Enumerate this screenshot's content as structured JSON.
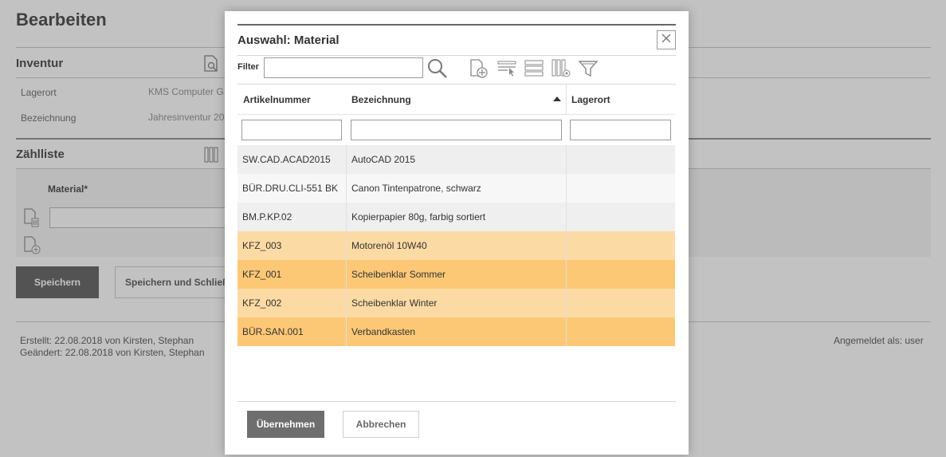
{
  "background_page": {
    "title": "Bearbeiten",
    "inventur": {
      "heading": "Inventur",
      "fields": [
        {
          "label": "Lagerort",
          "value": "KMS Computer G"
        },
        {
          "label": "Bezeichnung",
          "value": "Jahresinventur 20"
        }
      ]
    },
    "zaehlliste": {
      "heading": "Zählliste",
      "column_header": "Material*"
    },
    "buttons": {
      "save": "Speichern",
      "save_close": "Speichern und Schließ"
    },
    "footer": {
      "created": "Erstellt:  22.08.2018 von Kirsten, Stephan",
      "modified": "Geändert:  22.08.2018 von Kirsten, Stephan",
      "logged_in": "Angemeldet als: user"
    }
  },
  "dialog": {
    "title": "Auswahl: Material",
    "filter_label": "Filter",
    "filter_value": "",
    "icons": [
      "search-icon",
      "add-document-icon",
      "select-rows-icon",
      "list-view-icon",
      "column-settings-icon",
      "funnel-filter-icon"
    ],
    "table": {
      "columns": [
        {
          "key": "artikelnummer",
          "label": "Artikelnummer"
        },
        {
          "key": "bezeichnung",
          "label": "Bezeichnung",
          "sort": "ascending"
        },
        {
          "key": "lagerort",
          "label": "Lagerort"
        }
      ],
      "rows": [
        {
          "artikelnummer": "SW.CAD.ACAD2015",
          "bezeichnung": "AutoCAD 2015",
          "lagerort": "",
          "highlight": "none"
        },
        {
          "artikelnummer": "BÜR.DRU.CLI-551 BK",
          "bezeichnung": "Canon Tintenpatrone, schwarz",
          "lagerort": "",
          "highlight": "none"
        },
        {
          "artikelnummer": "BM.P.KP.02",
          "bezeichnung": "Kopierpapier 80g, farbig sortiert",
          "lagerort": "",
          "highlight": "none"
        },
        {
          "artikelnummer": "KFZ_003",
          "bezeichnung": "Motorenöl 10W40",
          "lagerort": "",
          "highlight": "light"
        },
        {
          "artikelnummer": "KFZ_001",
          "bezeichnung": "Scheibenklar Sommer",
          "lagerort": "",
          "highlight": "strong"
        },
        {
          "artikelnummer": "KFZ_002",
          "bezeichnung": "Scheibenklar Winter",
          "lagerort": "",
          "highlight": "light"
        },
        {
          "artikelnummer": "BÜR.SAN.001",
          "bezeichnung": "Verbandkasten",
          "lagerort": "",
          "highlight": "strong"
        }
      ]
    },
    "buttons": {
      "apply": "Übernehmen",
      "cancel": "Abbrechen"
    }
  },
  "colors": {
    "row_plain_a": "#efefef",
    "row_plain_b": "#f7f7f7",
    "row_highlight_light": "#fcdaa3",
    "row_highlight_strong": "#fcc876",
    "button_dark": "#6e6e6e",
    "overlay": "rgba(0,0,0,0.24)"
  }
}
